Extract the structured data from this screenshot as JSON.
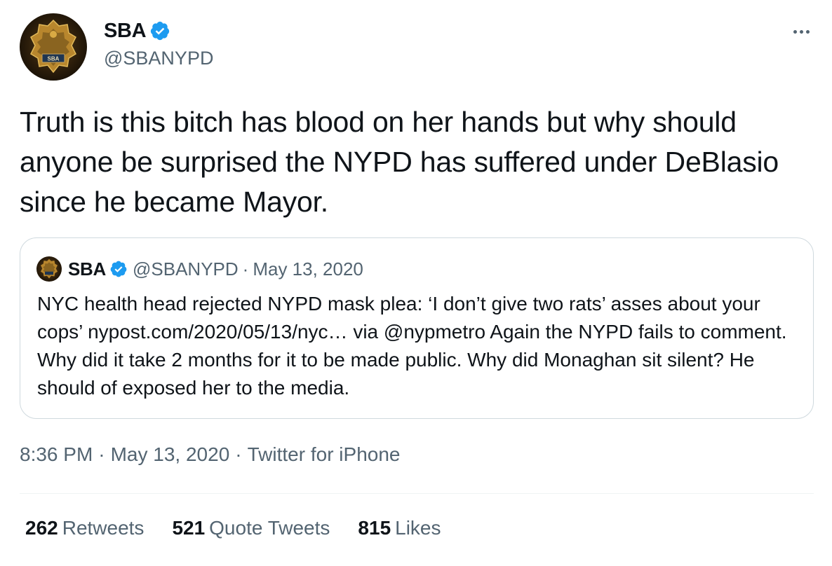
{
  "colors": {
    "text_primary": "#0f1419",
    "text_secondary": "#536471",
    "verified_blue": "#1d9bf0",
    "border": "#cfd9de"
  },
  "author": {
    "name": "SBA",
    "handle": "@SBANYPD",
    "verified_icon": "verified-badge-icon",
    "avatar_badge_text": "SBA"
  },
  "more_icon": "more-horizontal-icon",
  "tweet": {
    "text": "Truth is this bitch has blood on her hands but why should anyone be surprised the NYPD has suffered under DeBlasio since he became Mayor."
  },
  "quoted_tweet": {
    "name": "SBA",
    "handle": "@SBANYPD",
    "separator": "·",
    "date": "May 13, 2020",
    "text": "NYC health head rejected NYPD mask plea: ‘I don’t give two rats’ asses about your cops’ nypost.com/2020/05/13/nyc… via @nypmetro Again the NYPD fails to comment. Why did it take 2 months for it to be made public. Why did Monaghan sit silent? He should of exposed her to the media."
  },
  "meta": {
    "time": "8:36 PM",
    "separator": "·",
    "date": "May 13, 2020",
    "source": "Twitter for iPhone"
  },
  "stats": {
    "retweets_count": "262",
    "retweets_label": "Retweets",
    "quotes_count": "521",
    "quotes_label": "Quote Tweets",
    "likes_count": "815",
    "likes_label": "Likes"
  }
}
